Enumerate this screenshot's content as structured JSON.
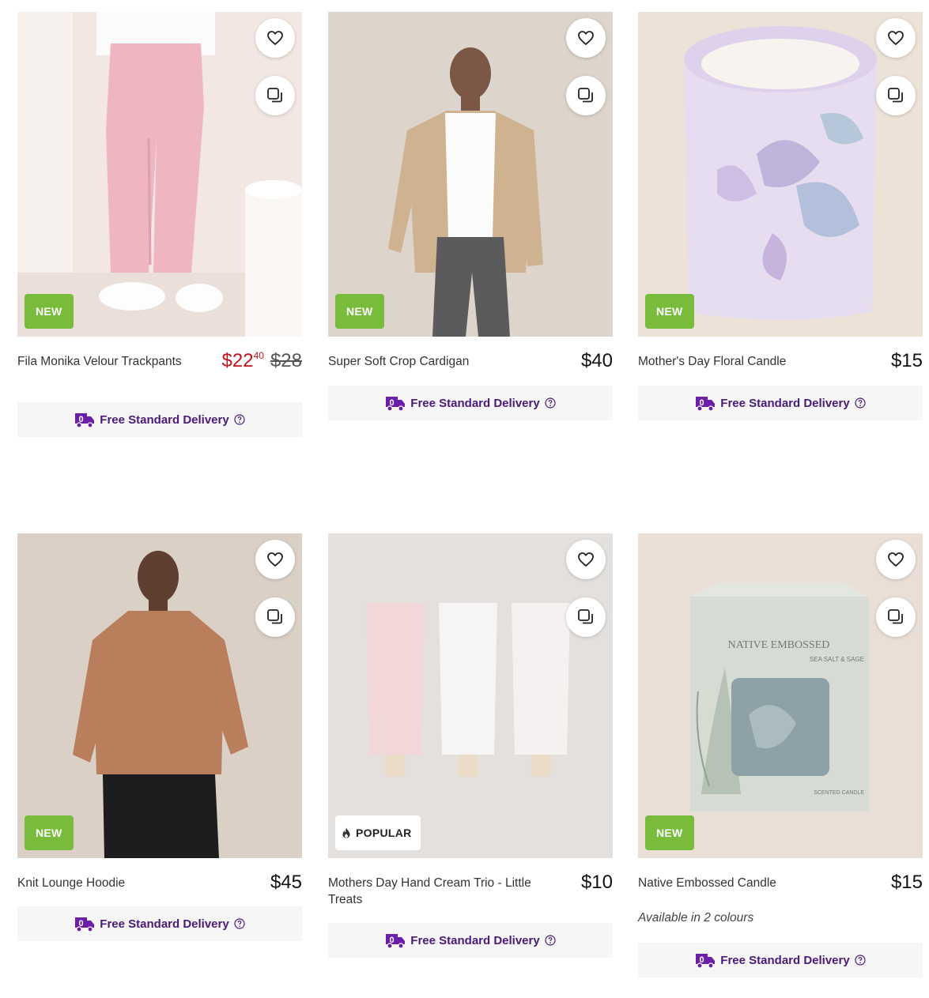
{
  "colors": {
    "new_badge": "#79bc3c",
    "sale_price": "#c3121b",
    "delivery_text": "#4a1a78",
    "delivery_bg": "#f6f6f6"
  },
  "icons": {
    "wishlist": "heart-icon",
    "compare": "compare-icon",
    "delivery": "delivery-truck-icon",
    "help": "help-circle-icon",
    "popular": "flame-icon"
  },
  "products": [
    {
      "name": "Fila Monika Velour Trackpants",
      "badge": "NEW",
      "price_sale_main": "$22",
      "price_sale_cents": "40",
      "price_was": "$28",
      "delivery": "Free Standard Delivery"
    },
    {
      "name": "Super Soft Crop Cardigan",
      "badge": "NEW",
      "price": "$40",
      "delivery": "Free Standard Delivery"
    },
    {
      "name": "Mother's Day Floral Candle",
      "badge": "NEW",
      "price": "$15",
      "delivery": "Free Standard Delivery"
    },
    {
      "name": "Knit Lounge Hoodie",
      "badge": "NEW",
      "price": "$45",
      "delivery": "Free Standard Delivery"
    },
    {
      "name": "Mothers Day Hand Cream Trio - Little Treats",
      "badge": "POPULAR",
      "price": "$10",
      "delivery": "Free Standard Delivery"
    },
    {
      "name": "Native Embossed Candle",
      "badge": "NEW",
      "price": "$15",
      "availability": "Available in 2 colours",
      "delivery": "Free Standard Delivery",
      "image_text": {
        "title": "NATIVE EMBOSSED",
        "scent": "SEA SALT & SAGE",
        "footer": "SCENTED CANDLE"
      }
    }
  ]
}
